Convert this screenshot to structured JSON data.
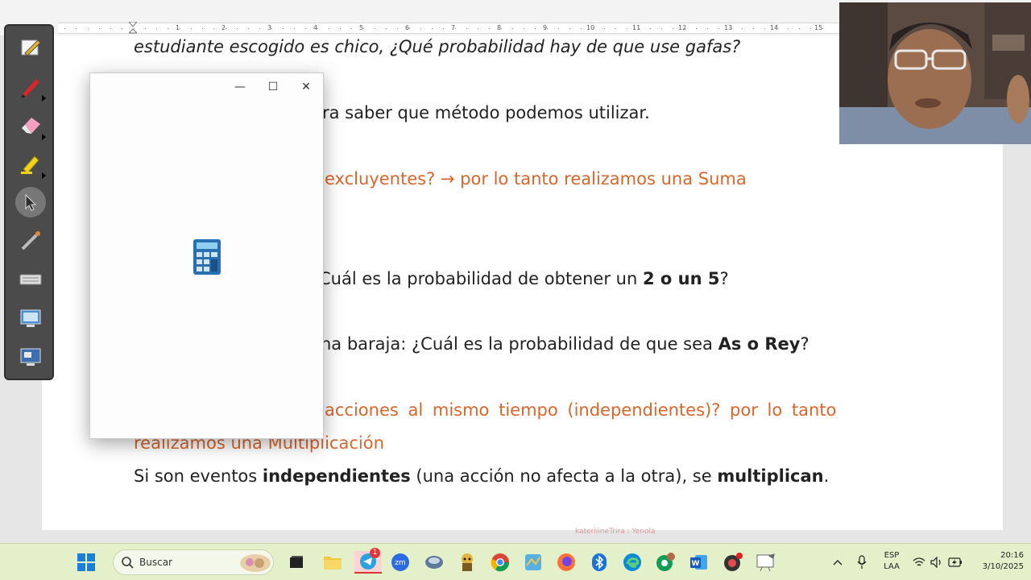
{
  "ruler": {
    "ticks": [
      "1",
      "2",
      "3",
      "4",
      "5",
      "6",
      "7",
      "8",
      "9",
      "10",
      "11",
      "12",
      "13",
      "14",
      "15"
    ]
  },
  "document": {
    "line1": "estudiante escogido es chico, ¿Qué probabilidad hay de que use gafas?",
    "line2": "ra saber que método podemos utilizar.",
    "line3": "excluyentes? → por lo tanto realizamos una Suma",
    "line4": {
      "a": "Cuál es la probabilidad de obtener un ",
      "b": "2 o un 5",
      "c": "?"
    },
    "line5": {
      "a": "na baraja: ¿Cuál es la probabilidad de que sea ",
      "b": "As o Rey",
      "c": "?"
    },
    "line6": "acciones al mismo tiempo (independientes)? por lo tanto",
    "line7": "realizamos una Multiplicación",
    "line8": {
      "a": "Si son eventos ",
      "b": "independientes",
      "c": " (una acción no afecta a la otra), se ",
      "d": "multiplican",
      "e": "."
    }
  },
  "calculator": {
    "minimize": "—",
    "maximize": "☐",
    "close": "✕"
  },
  "watermark": "kateriiineTrira : Yenola",
  "taskbar": {
    "search_placeholder": "Buscar",
    "telegram_badge": "1",
    "lang": "ESP",
    "layout": "LAA",
    "time": "20:16",
    "date": "3/10/2025"
  },
  "colors": {
    "accent_text": "#d9662c",
    "taskbar_bg": "#e3f0c9",
    "toolbar_bg": "#4b4b4b"
  }
}
